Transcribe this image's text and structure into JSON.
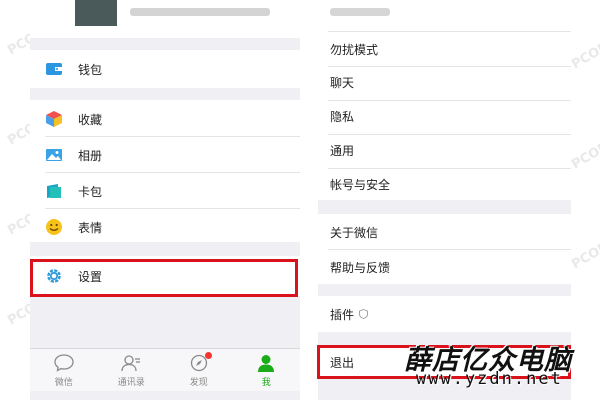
{
  "left": {
    "top_items": [
      {
        "label": "钱包",
        "icon": "wallet-icon"
      }
    ],
    "middle_items": [
      {
        "label": "收藏",
        "icon": "favorites-cube-icon"
      },
      {
        "label": "相册",
        "icon": "album-photo-icon"
      },
      {
        "label": "卡包",
        "icon": "card-wallet-icon"
      },
      {
        "label": "表情",
        "icon": "sticker-smiley-icon"
      }
    ],
    "settings_item": {
      "label": "设置",
      "icon": "settings-gear-icon"
    },
    "tabs": [
      {
        "label": "微信",
        "icon": "chat-bubble-icon"
      },
      {
        "label": "通讯录",
        "icon": "contacts-icon"
      },
      {
        "label": "发现",
        "icon": "compass-icon"
      },
      {
        "label": "我",
        "icon": "me-person-icon"
      }
    ]
  },
  "right": {
    "group1": [
      "勿扰模式",
      "聊天",
      "隐私",
      "通用",
      "帐号与安全"
    ],
    "group2": [
      "关于微信",
      "帮助与反馈"
    ],
    "plugin": {
      "label": "插件"
    },
    "logout": {
      "label": "退出"
    }
  },
  "colors": {
    "accent_green": "#1aad19",
    "highlight_red": "#d9121c",
    "settings_blue": "#2f9ad8",
    "background_gray": "#efeff4"
  },
  "brand": {
    "title": "薛店亿众电脑",
    "url": "www.yzdn.net"
  }
}
